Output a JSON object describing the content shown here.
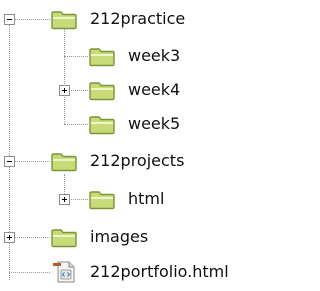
{
  "tree": {
    "items": [
      {
        "label": "212practice",
        "type": "folder",
        "state": "expanded"
      },
      {
        "label": "week3",
        "type": "folder",
        "state": "leaf"
      },
      {
        "label": "week4",
        "type": "folder",
        "state": "collapsed"
      },
      {
        "label": "week5",
        "type": "folder",
        "state": "leaf"
      },
      {
        "label": "212projects",
        "type": "folder",
        "state": "expanded"
      },
      {
        "label": "html",
        "type": "folder",
        "state": "collapsed"
      },
      {
        "label": "images",
        "type": "folder",
        "state": "collapsed"
      },
      {
        "label": "212portfolio.html",
        "type": "html-file",
        "state": "leaf"
      }
    ]
  },
  "colors": {
    "background": "#ffffff",
    "folder_fill": "#c8db78",
    "folder_stroke": "#7c9438",
    "connector": "#9a9a9a",
    "text": "#111111"
  }
}
